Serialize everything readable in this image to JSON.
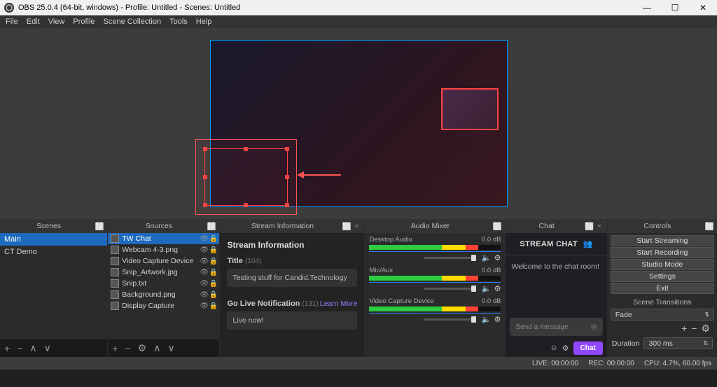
{
  "title": "OBS 25.0.4 (64-bit, windows) - Profile: Untitled - Scenes: Untitled",
  "menubar": [
    "File",
    "Edit",
    "View",
    "Profile",
    "Scene Collection",
    "Tools",
    "Help"
  ],
  "scenes": {
    "header": "Scenes",
    "items": [
      "Main",
      "CT Demo"
    ]
  },
  "sources": {
    "header": "Sources",
    "items": [
      {
        "name": "TW Chat"
      },
      {
        "name": "Webcam 4-3.png"
      },
      {
        "name": "Video Capture Device"
      },
      {
        "name": "Snip_Artwork.jpg"
      },
      {
        "name": "Snip.txt"
      },
      {
        "name": "Background.png"
      },
      {
        "name": "Display Capture"
      }
    ]
  },
  "stream_info": {
    "header": "Stream Information",
    "heading": "Stream Information",
    "title_label": "Title",
    "title_count": "(104)",
    "title_value": "Testing stuff for Candid.Technology",
    "live_label": "Go Live Notification",
    "live_count": "(131)",
    "learn_more": "Learn More",
    "live_value": "Live now!"
  },
  "mixer": {
    "header": "Audio Mixer",
    "items": [
      {
        "name": "Desktop Audio",
        "db": "0.0 dB"
      },
      {
        "name": "Mic/Aux",
        "db": "0.0 dB"
      },
      {
        "name": "Video Capture Device",
        "db": "0.0 dB"
      }
    ]
  },
  "chat": {
    "header": "Chat",
    "title": "STREAM CHAT",
    "welcome": "Welcome to the chat room!",
    "placeholder": "Send a message",
    "button": "Chat"
  },
  "controls": {
    "header": "Controls",
    "buttons": [
      "Start Streaming",
      "Start Recording",
      "Studio Mode",
      "Settings",
      "Exit"
    ],
    "transitions_header": "Scene Transitions",
    "transition": "Fade",
    "duration_label": "Duration",
    "duration_value": "300 ms"
  },
  "statusbar": {
    "live": "LIVE: 00:00:00",
    "rec": "REC: 00:00:00",
    "cpu": "CPU: 4.7%, 60.00 fps"
  }
}
